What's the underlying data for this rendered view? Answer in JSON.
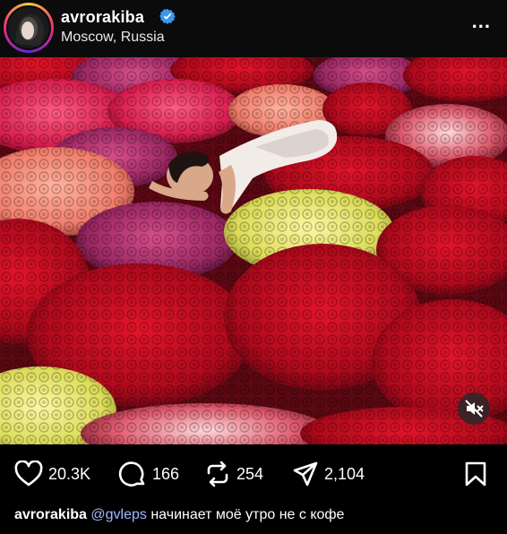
{
  "post": {
    "username": "avrorakiba",
    "location": "Moscow, Russia",
    "more_label": "...",
    "likes": "20.3K",
    "comments": "166",
    "reposts": "254",
    "shares": "2,104",
    "caption_user": "avrorakiba",
    "caption_mention": "@gvleps",
    "caption_text": "начинает моё утро не с кофе"
  },
  "icons": {
    "verified": "verified-badge-icon",
    "more": "more-options-icon",
    "mute": "muted-speaker-icon",
    "like": "heart-icon",
    "comment": "comment-bubble-icon",
    "repost": "repost-arrows-icon",
    "share": "paper-plane-icon",
    "save": "bookmark-icon"
  },
  "colors": {
    "background": "#000000",
    "verified": "#3897f0",
    "mention": "#9db8ff"
  }
}
